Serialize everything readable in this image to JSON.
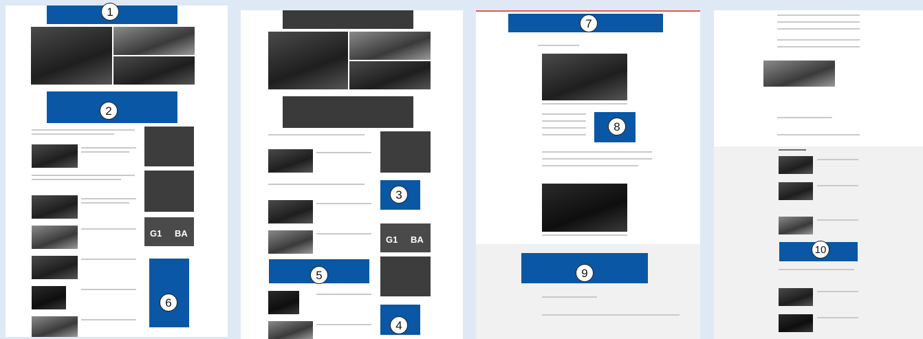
{
  "markers": {
    "m1": "1",
    "m2": "2",
    "m3": "3",
    "m4": "4",
    "m5": "5",
    "m6": "6",
    "m7": "7",
    "m8": "8",
    "m9": "9",
    "m10": "10"
  },
  "logos": {
    "g1_a": "G1",
    "g1_b": "BA"
  },
  "colors": {
    "ad_slot": "#0a57a5",
    "placeholder": "#3a3a3a",
    "page_background": "#dfe9f6"
  }
}
